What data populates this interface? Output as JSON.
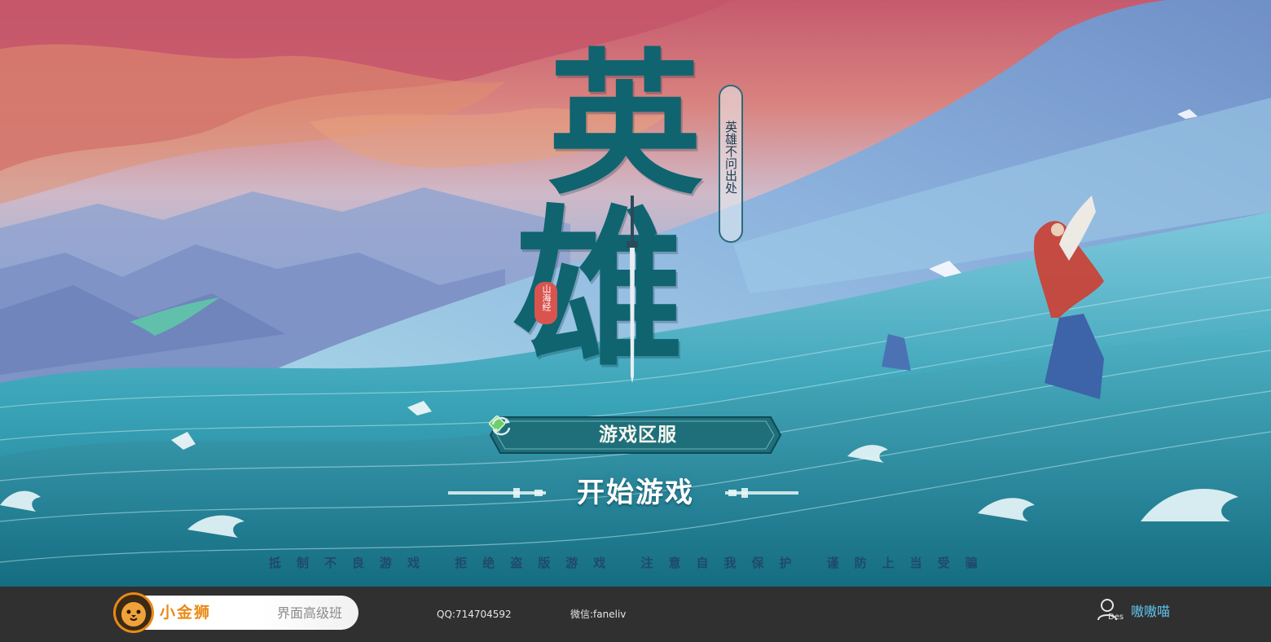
{
  "title": {
    "char1": "英",
    "char2": "雄",
    "slogan": "英雄不问出处",
    "seal": "山海经"
  },
  "server": {
    "label": "游戏区服"
  },
  "start": {
    "label": "开始游戏"
  },
  "notice": "抵制不良游戏  拒绝盗版游戏  注意自我保护  谨防上当受骗",
  "footer": {
    "brand_name": "小金狮",
    "brand_sub": "界面高级班",
    "qq": "QQ:714704592",
    "wechat": "微信:faneliv",
    "user_badge": "Des",
    "username": "嗷嗷喵"
  },
  "colors": {
    "title_teal": "#0f6470",
    "server_bar": "#1e6f7a",
    "footer_bg": "#303030",
    "brand_orange": "#e98a16",
    "username_blue": "#5fc4f0",
    "gem_green": "#6ecf6b"
  },
  "icons": {
    "server_gem": "diamond-gem-icon",
    "refresh": "refresh-icon",
    "user": "user-icon",
    "logo": "lion-logo-icon"
  }
}
